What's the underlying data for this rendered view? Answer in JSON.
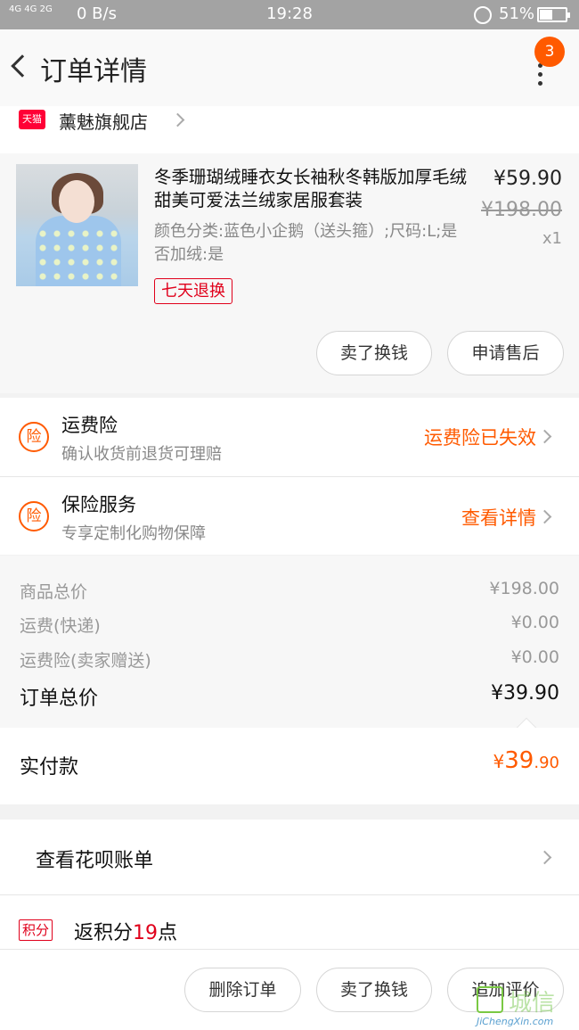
{
  "status_bar": {
    "signal": "4G 4G 2G",
    "net_speed": "0 B/s",
    "time": "19:28",
    "battery": "51%",
    "battery_level": 0.51
  },
  "nav": {
    "title": "订单详情",
    "badge": "3"
  },
  "store": {
    "logo_text": "天猫",
    "name": "薰魅旗舰店"
  },
  "product": {
    "title": "冬季珊瑚绒睡衣女长袖秋冬韩版加厚毛绒甜美可爱法兰绒家居服套装",
    "sku": "颜色分类:蓝色小企鹅（送头箍）;尺码:L;是否加绒:是",
    "price": "¥59.90",
    "original_price": "¥198.00",
    "quantity": "x1",
    "return_tag": "七天退换",
    "actions": [
      "卖了换钱",
      "申请售后"
    ]
  },
  "insurance": [
    {
      "icon": "险",
      "title": "运费险",
      "subtitle": "确认收货前退货可理赔",
      "status": "运费险已失效"
    },
    {
      "icon": "险",
      "title": "保险服务",
      "subtitle": "专享定制化购物保障",
      "status": "查看详情"
    }
  ],
  "summary": {
    "rows": [
      {
        "label": "商品总价",
        "value": "¥198.00"
      },
      {
        "label": "运费(快递)",
        "value": "¥0.00"
      },
      {
        "label": "运费险(卖家赠送)",
        "value": "¥0.00"
      }
    ],
    "total_label": "订单总价",
    "total_value": "¥39.90",
    "paid_label": "实付款",
    "paid_currency": "¥",
    "paid_int": "39",
    "paid_dec": ".90"
  },
  "huabei": {
    "label": "查看花呗账单"
  },
  "points": {
    "tag": "积分",
    "prefix": "返积分",
    "num": "19",
    "suffix": "点"
  },
  "bottom_actions": [
    "删除订单",
    "卖了换钱",
    "追加评价"
  ],
  "watermark": {
    "cn": "城信",
    "en": "JiChengXin.com"
  },
  "colors": {
    "accent": "#ff5a00",
    "tmall_red": "#e0001b",
    "statusbar": "#a3a3a3"
  }
}
